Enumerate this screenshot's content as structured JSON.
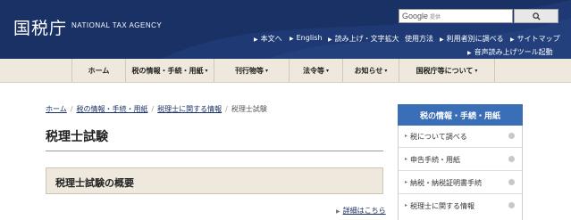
{
  "header": {
    "logo": "国税庁",
    "logo_en": "NATIONAL TAX AGENCY",
    "search_brand": "Google",
    "search_placeholder": "提供",
    "search_button_icon": "search-icon",
    "utility_links": [
      "本文へ",
      "English",
      "読み上げ・文字拡大",
      "使用方法",
      "利用者別に調べる",
      "サイトマップ"
    ],
    "reader_link": "音声読み上げツール起動",
    "bg_color": "#1a3166"
  },
  "nav": {
    "items": [
      "ホーム",
      "税の情報・手続・用紙",
      "刊行物等",
      "法令等",
      "お知らせ",
      "国税庁等について"
    ]
  },
  "breadcrumb": {
    "items": [
      "ホーム",
      "税の情報・手続・用紙",
      "税理士に関する情報",
      "税理士試験"
    ]
  },
  "page": {
    "title": "税理士試験",
    "section_title": "税理士試験の概要",
    "more_link": "詳細はこちら"
  },
  "sidebar": {
    "heading": "税の情報・手続・用紙",
    "heading_color": "#3a6fb8",
    "items": [
      "税について調べる",
      "申告手続・用紙",
      "納税・納税証明書手続",
      "税理士に関する情報"
    ]
  }
}
